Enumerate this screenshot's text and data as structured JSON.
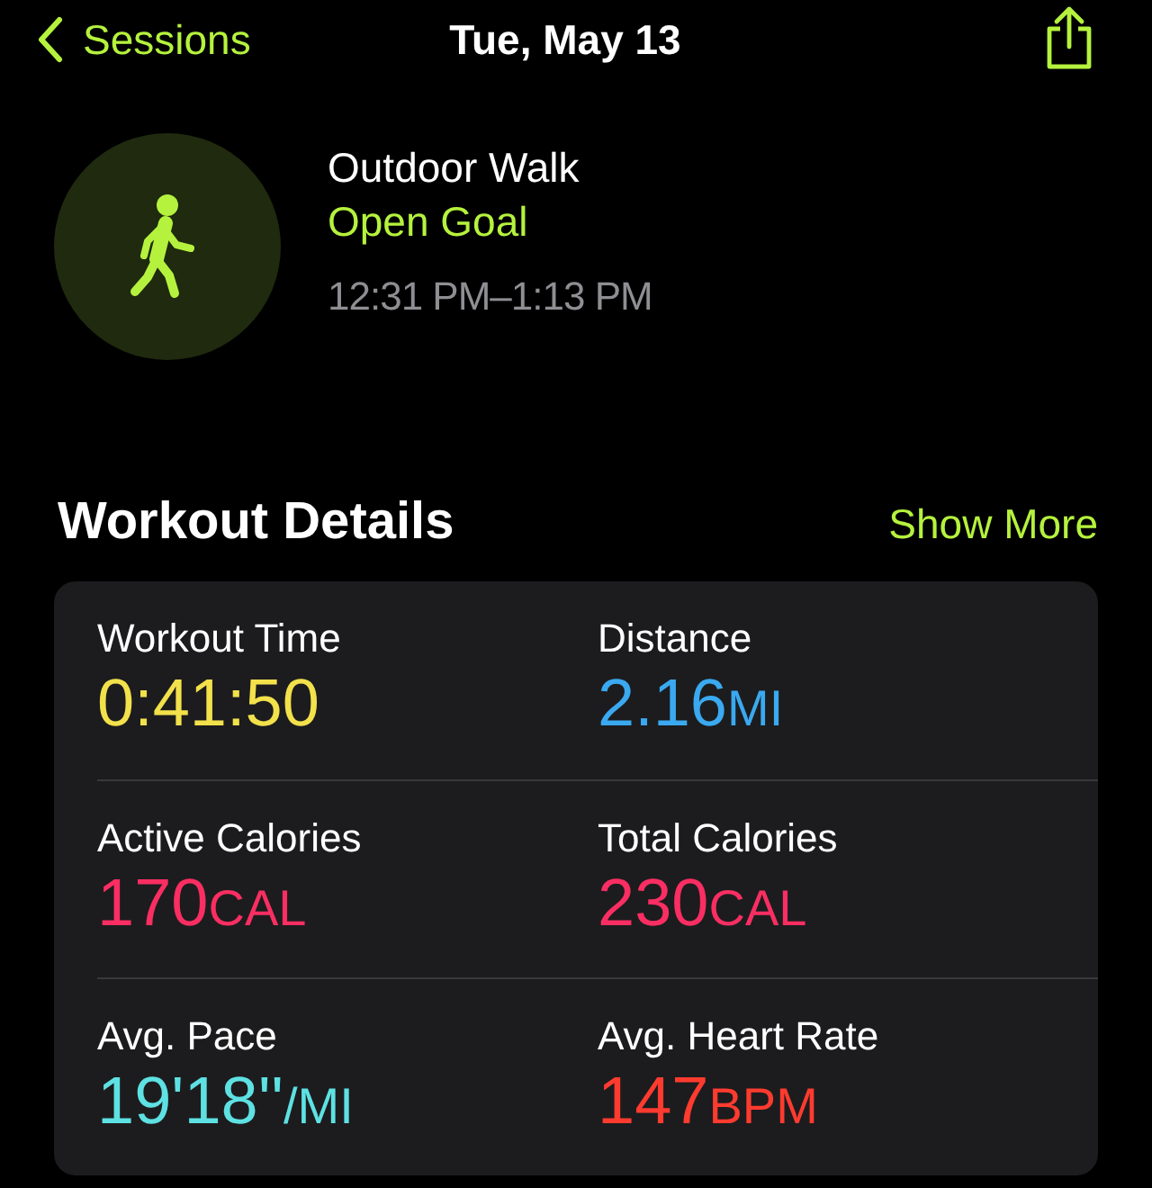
{
  "nav": {
    "back_label": "Sessions",
    "title": "Tue, May 13"
  },
  "workout": {
    "name": "Outdoor Walk",
    "goal": "Open Goal",
    "time_range": "12:31 PM–1:13 PM"
  },
  "details": {
    "title": "Workout Details",
    "action": "Show More",
    "metrics": [
      {
        "label": "Workout Time",
        "value": "0:41:50",
        "color": "#f2e14b"
      },
      {
        "label": "Distance",
        "value": "2.16",
        "unit": "MI",
        "color": "#3aa9f0"
      },
      {
        "label": "Active Calories",
        "value": "170",
        "unit": "CAL",
        "color": "#fa2e62"
      },
      {
        "label": "Total Calories",
        "value": "230",
        "unit": "CAL",
        "color": "#fa2e62"
      },
      {
        "label": "Avg. Pace",
        "value": "19'18''",
        "unit": "/MI",
        "color": "#5ee1e3"
      },
      {
        "label": "Avg. Heart Rate",
        "value": "147",
        "unit": "BPM",
        "color": "#ff3b2f"
      }
    ]
  }
}
